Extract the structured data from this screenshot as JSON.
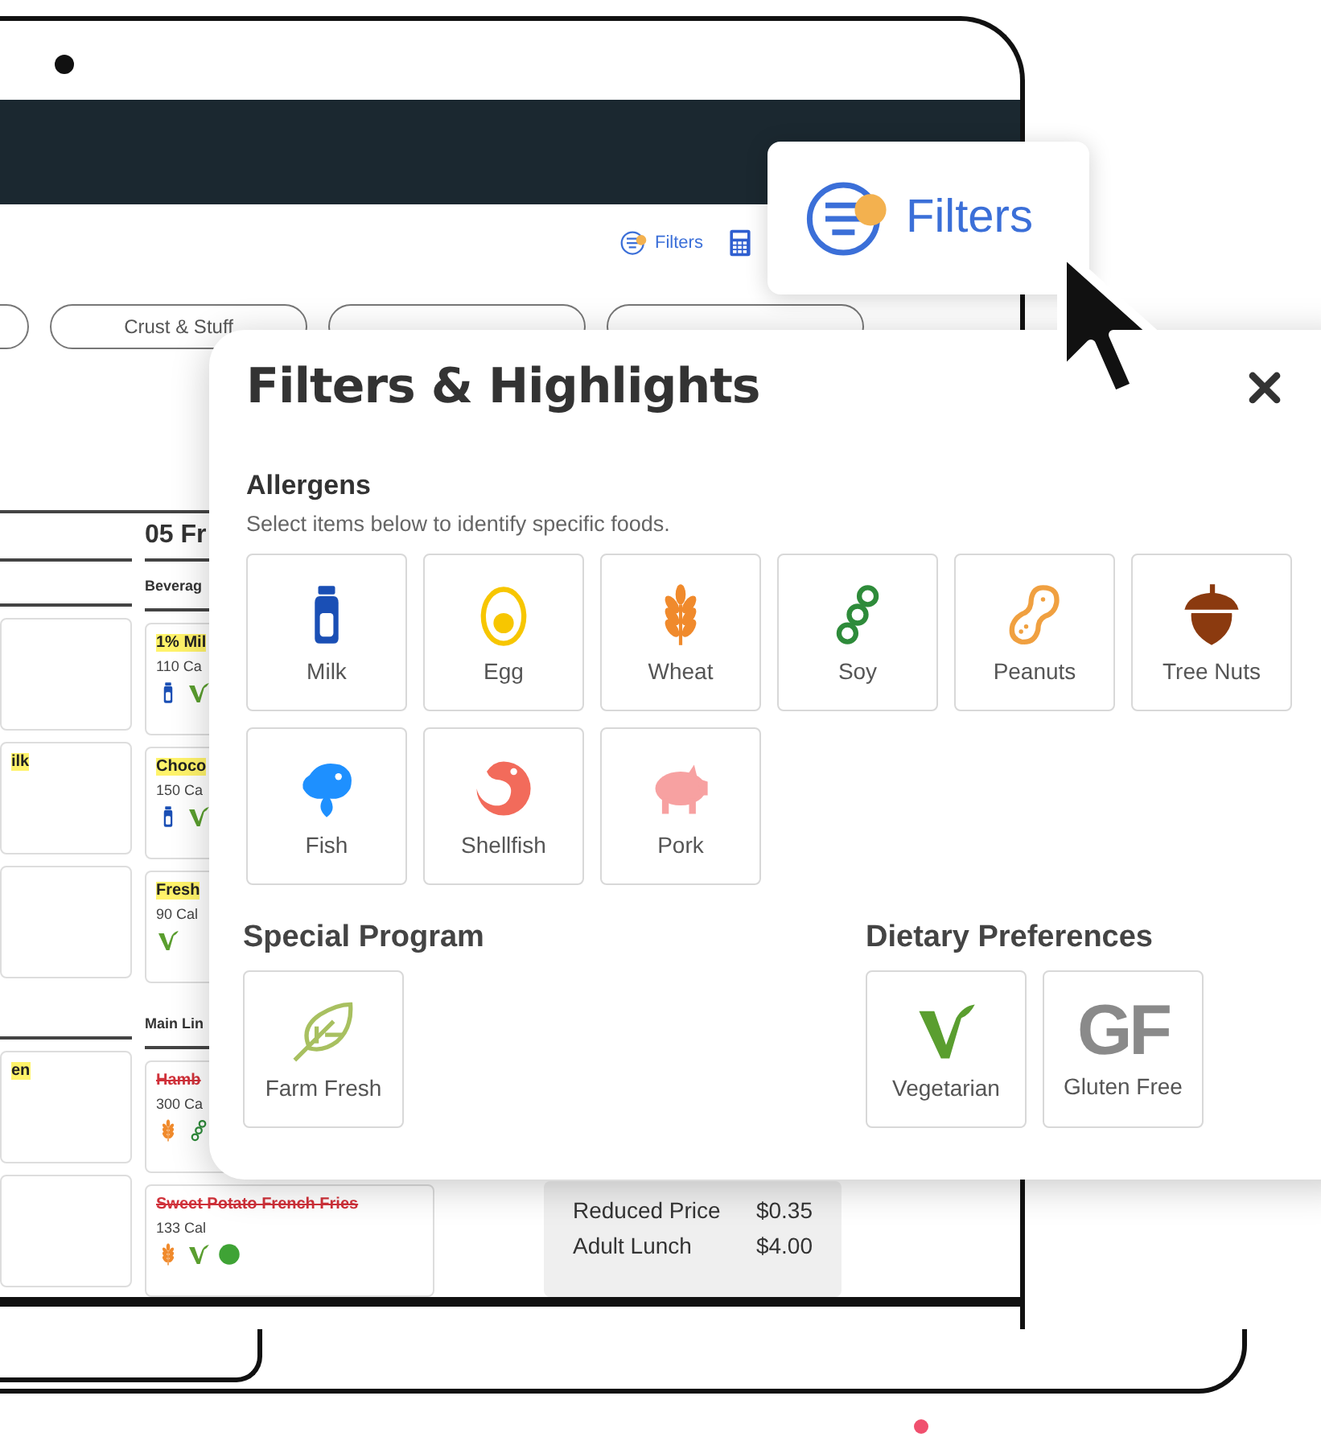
{
  "screen": {
    "toolbar": [
      {
        "kind": "filters",
        "label": "Filters"
      },
      {
        "kind": "calculator"
      }
    ],
    "pills": [
      {
        "kind": "cut"
      },
      {
        "kind": "labeled",
        "label": "Crust & Stuff"
      },
      {
        "kind": "covered"
      },
      {
        "kind": "covered"
      }
    ],
    "menu": {
      "day_header": "05 Fr",
      "left_cards": [
        [
          {
            "kind": "blank"
          },
          {
            "kind": "text",
            "name": "ilk"
          },
          {
            "kind": "blank"
          }
        ],
        [
          {
            "kind": "text",
            "name": "en"
          },
          {
            "kind": "blank"
          }
        ]
      ],
      "sections": [
        {
          "title": "Beverag",
          "items": [
            {
              "name": "1% Mil",
              "kind": "highlighted",
              "calories": "110 Ca",
              "icons": [
                {
                  "kind": "milk"
                },
                {
                  "kind": "vegetarian"
                }
              ]
            },
            {
              "name": "Choco",
              "kind": "highlighted",
              "calories": "150 Ca",
              "icons": [
                {
                  "kind": "milk"
                },
                {
                  "kind": "vegetarian"
                }
              ]
            },
            {
              "name": "Fresh",
              "kind": "highlighted",
              "calories": "90 Cal",
              "icons": [
                {
                  "kind": "vegetarian"
                }
              ]
            }
          ]
        },
        {
          "title": "Main Lin",
          "items": [
            {
              "name": "Hamb",
              "kind": "struck",
              "calories": "300 Ca",
              "icons": [
                {
                  "kind": "wheat"
                },
                {
                  "kind": "soy"
                }
              ]
            },
            {
              "name": "Sweet Potato French Fries",
              "kind": "struck",
              "calories": "133 Cal",
              "icons": [
                {
                  "kind": "wheat"
                },
                {
                  "kind": "vegetarian"
                },
                {
                  "kind": "dot"
                }
              ]
            }
          ]
        }
      ]
    },
    "prices": [
      {
        "label": "Reduced Price",
        "price": "$0.35"
      },
      {
        "label": "Adult Lunch",
        "price": "$4.00"
      }
    ]
  },
  "callout": {
    "label": "Filters"
  },
  "popup": {
    "title": "Filters & Highlights",
    "allergens": {
      "title": "Allergens",
      "subtitle": "Select items below to identify specific foods.",
      "items": [
        {
          "label": "Milk",
          "kind": "milk"
        },
        {
          "label": "Egg",
          "kind": "egg"
        },
        {
          "label": "Wheat",
          "kind": "wheat"
        },
        {
          "label": "Soy",
          "kind": "soy"
        },
        {
          "label": "Peanuts",
          "kind": "peanut"
        },
        {
          "label": "Tree Nuts",
          "kind": "acorn"
        },
        {
          "label": "Fish",
          "kind": "fish"
        },
        {
          "label": "Shellfish",
          "kind": "shrimp"
        },
        {
          "label": "Pork",
          "kind": "pig"
        }
      ]
    },
    "special_program": {
      "title": "Special Program",
      "items": [
        {
          "label": "Farm Fresh",
          "kind": "leaf"
        }
      ]
    },
    "dietary_preferences": {
      "title": "Dietary Preferences",
      "items": [
        {
          "label": "Vegetarian",
          "kind": "vegetarian"
        },
        {
          "label": "Gluten Free",
          "kind": "mark",
          "mark": "GF"
        }
      ]
    }
  }
}
